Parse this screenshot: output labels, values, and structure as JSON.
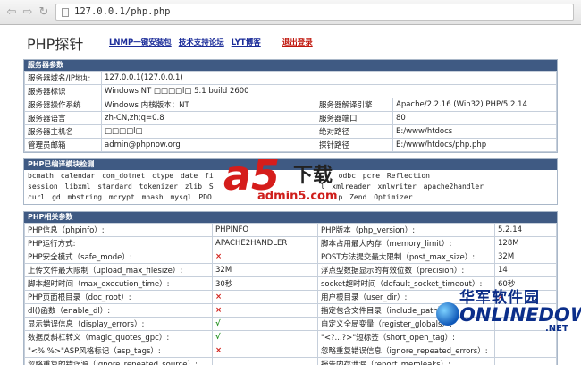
{
  "browser": {
    "url": "127.0.0.1/php.php",
    "back_glyph": "⇦",
    "forward_glyph": "⇨",
    "reload_glyph": "↻"
  },
  "header": {
    "logo": "PHP探针",
    "links": [
      "LNMP一键安装包",
      "技术支持论坛",
      "LYT博客"
    ],
    "logout": "退出登录"
  },
  "server": {
    "title": "服务器参数",
    "rows": [
      [
        "服务器域名/IP地址",
        "127.0.0.1(127.0.0.1)",
        "",
        ""
      ],
      [
        "服务器标识",
        "Windows NT □□□□l□ 5.1 build 2600",
        "",
        ""
      ],
      [
        "服务器操作系统",
        "Windows  内核版本：NT",
        "服务器解译引擎",
        "Apache/2.2.16 (Win32) PHP/5.2.14"
      ],
      [
        "服务器语言",
        "zh-CN,zh;q=0.8",
        "服务器端口",
        "80"
      ],
      [
        "服务器主机名",
        "□□□□l□",
        "绝对路径",
        "E:/www/htdocs"
      ],
      [
        "管理员邮箱",
        "admin@phpnow.org",
        "探针路径",
        "E:/www/htdocs/php.php"
      ]
    ]
  },
  "modules": {
    "title": "PHP已编译模块检测",
    "line1": "bcmath  calendar  com_dotnet  ctype  date  fi",
    "line1b": "odbc  pcre  Reflection",
    "line2": "session  libxml  standard  tokenizer  zlib  S",
    "line2b": "l  xmlreader  xmlwriter  apache2handler",
    "line3": "curl  gd  mbstring  mcrypt  mhash  mysql  PDO",
    "line3b": "zip  Zend Optimizer"
  },
  "php": {
    "title": "PHP相关参数",
    "rows": [
      [
        "PHP信息（phpinfo）:",
        "PHPINFO",
        "PHP版本（php_version）:",
        "5.2.14"
      ],
      [
        "PHP运行方式:",
        "APACHE2HANDLER",
        "脚本占用最大内存（memory_limit）:",
        "128M"
      ],
      [
        "PHP安全模式（safe_mode）:",
        "×",
        "POST方法提交最大限制（post_max_size）:",
        "32M"
      ],
      [
        "上传文件最大限制（upload_max_filesize）:",
        "32M",
        "浮点型数据显示的有效位数（precision）:",
        "14"
      ],
      [
        "脚本超时时间（max_execution_time）:",
        "30秒",
        "socket超时时间（default_socket_timeout）:",
        "60秒"
      ],
      [
        "PHP页面根目录（doc_root）:",
        "×",
        "用户根目录（user_dir）:",
        "×"
      ],
      [
        "dl()函数（enable_dl）:",
        "×",
        "指定包含文件目录（include_path）:",
        ""
      ],
      [
        "显示错误信息（display_errors）:",
        "√",
        "自定义全局变量（register_globals）:",
        ""
      ],
      [
        "数据反斜杠转义（magic_quotes_gpc）:",
        "√",
        "\"<?...?>\"短标签（short_open_tag）:",
        ""
      ],
      [
        "\"<% %>\"ASP风格标记（asp_tags）:",
        "×",
        "忽略重复错误信息（ignore_repeated_errors）:",
        ""
      ],
      [
        "忽略重复的错误源（ignore_repeated_source）:",
        "",
        "报告内存泄漏（report_memleaks）:",
        ""
      ]
    ]
  },
  "watermarks": {
    "a5_logo": "a5",
    "a5_xiazai": "下载",
    "a5_site": "admin5.com",
    "ol_cn": "华军软件园",
    "ol_en": "ONLINEDOWN",
    "ol_net": ".NET"
  },
  "colors": {
    "section_bar": "#3f5a83",
    "link": "#1b2c99",
    "logout": "#c0170d",
    "cross": "#d2201a",
    "check": "#1f8f1b"
  }
}
